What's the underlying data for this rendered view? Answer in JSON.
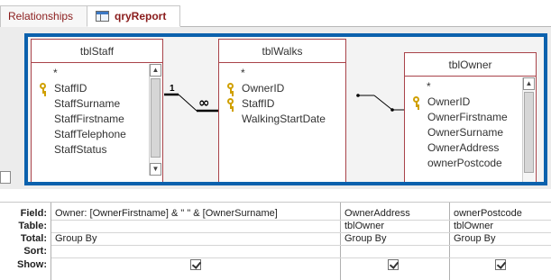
{
  "tabs": [
    {
      "label": "Relationships"
    },
    {
      "label": "qryReport"
    }
  ],
  "tables": {
    "staff": {
      "title": "tblStaff",
      "fields": [
        "*",
        "StaffID",
        "StaffSurname",
        "StaffFirstname",
        "StaffTelephone",
        "StaffStatus"
      ]
    },
    "walks": {
      "title": "tblWalks",
      "fields": [
        "*",
        "OwnerID",
        "StaffID",
        "WalkingStartDate"
      ]
    },
    "owner": {
      "title": "tblOwner",
      "fields": [
        "*",
        "OwnerID",
        "OwnerFirstname",
        "OwnerSurname",
        "OwnerAddress",
        "ownerPostcode"
      ]
    }
  },
  "relationship": {
    "one_label": "1",
    "many_label": "∞"
  },
  "grid": {
    "row_labels": [
      "Field:",
      "Table:",
      "Total:",
      "Sort:",
      "Show:"
    ],
    "columns": [
      {
        "field": "Owner: [OwnerFirstname] & \" \" & [OwnerSurname]",
        "table": "",
        "total": "Group By",
        "sort": "",
        "show": true
      },
      {
        "field": "OwnerAddress",
        "table": "tblOwner",
        "total": "Group By",
        "sort": "",
        "show": true
      },
      {
        "field": "ownerPostcode",
        "table": "tblOwner",
        "total": "Group By",
        "sort": "",
        "show": true
      }
    ]
  }
}
